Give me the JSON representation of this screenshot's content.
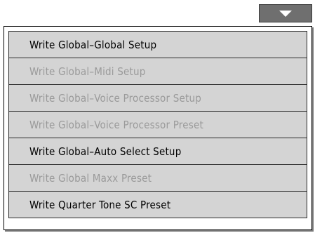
{
  "dropdown": {
    "icon": "triangle-down-icon"
  },
  "menu": {
    "items": [
      {
        "label": "Write Global–Global Setup",
        "enabled": true
      },
      {
        "label": "Write Global–Midi Setup",
        "enabled": false
      },
      {
        "label": "Write Global–Voice Processor Setup",
        "enabled": false
      },
      {
        "label": "Write Global–Voice Processor Preset",
        "enabled": false
      },
      {
        "label": "Write Global–Auto Select Setup",
        "enabled": true
      },
      {
        "label": "Write Global Maxx Preset",
        "enabled": false
      },
      {
        "label": "Write Quarter Tone SC Preset",
        "enabled": true
      }
    ]
  }
}
